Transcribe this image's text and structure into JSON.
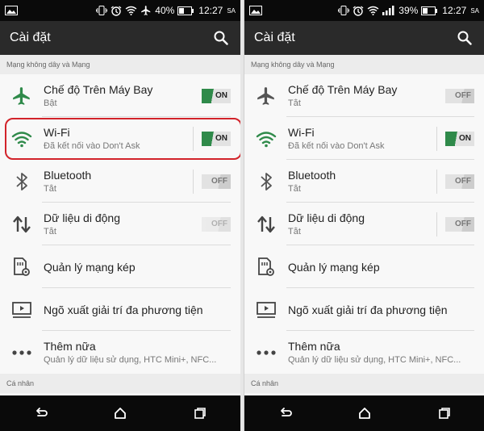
{
  "screens": [
    {
      "status": {
        "battery_pct": "40%",
        "time": "12:27",
        "ampm": "SA"
      },
      "appbar": {
        "title": "Cài đặt",
        "search_icon": "search-icon"
      },
      "section_network": "Mạng không dây và Mạng",
      "items": [
        {
          "title": "Chế độ Trên Máy Bay",
          "subtitle": "Bật",
          "icon": "airplane-icon",
          "toggle": "ON"
        },
        {
          "title": "Wi-Fi",
          "subtitle": "Đã kết nối vào Don't Ask",
          "icon": "wifi-icon",
          "toggle": "ON"
        },
        {
          "title": "Bluetooth",
          "subtitle": "Tắt",
          "icon": "bluetooth-icon",
          "toggle": "OFF"
        },
        {
          "title": "Dữ liệu di động",
          "subtitle": "Tắt",
          "icon": "mobile-data-icon",
          "toggle": "OFF"
        },
        {
          "title": "Quản lý mạng kép",
          "icon": "dual-sim-icon"
        },
        {
          "title": "Ngõ xuất giải trí đa phương tiện",
          "icon": "media-output-icon"
        },
        {
          "title": "Thêm nữa",
          "subtitle": "Quản lý dữ liệu sử dụng, HTC Mini+, NFC...",
          "icon": "more-icon"
        }
      ],
      "section_personal": "Cá nhân"
    },
    {
      "status": {
        "battery_pct": "39%",
        "time": "12:27",
        "ampm": "SA"
      },
      "appbar": {
        "title": "Cài đặt",
        "search_icon": "search-icon"
      },
      "section_network": "Mạng không dây và Mạng",
      "items": [
        {
          "title": "Chế độ Trên Máy Bay",
          "subtitle": "Tắt",
          "icon": "airplane-icon",
          "toggle": "OFF"
        },
        {
          "title": "Wi-Fi",
          "subtitle": "Đã kết nối vào Don't Ask",
          "icon": "wifi-icon",
          "toggle": "ON"
        },
        {
          "title": "Bluetooth",
          "subtitle": "Tắt",
          "icon": "bluetooth-icon",
          "toggle": "OFF"
        },
        {
          "title": "Dữ liệu di động",
          "subtitle": "Tắt",
          "icon": "mobile-data-icon",
          "toggle": "OFF"
        },
        {
          "title": "Quản lý mạng kép",
          "icon": "dual-sim-icon"
        },
        {
          "title": "Ngõ xuất giải trí đa phương tiện",
          "icon": "media-output-icon"
        },
        {
          "title": "Thêm nữa",
          "subtitle": "Quản lý dữ liệu sử dụng, HTC Mini+, NFC...",
          "icon": "more-icon"
        }
      ],
      "section_personal": "Cá nhân"
    }
  ],
  "colors": {
    "accent_green": "#2f8a4a",
    "highlight_red": "#d2232a",
    "appbar": "#2a2a2a"
  }
}
